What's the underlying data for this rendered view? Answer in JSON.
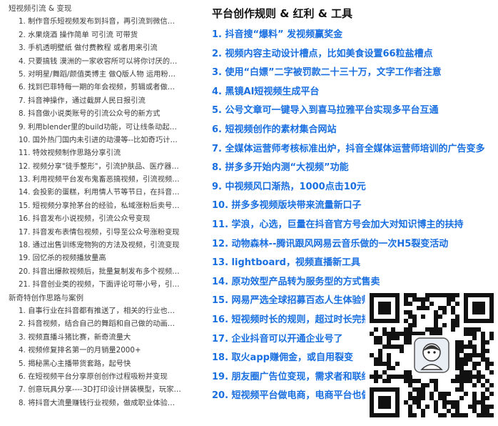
{
  "left": {
    "section1_title": "短视频引流 & 变现",
    "section1_items": [
      "1. 制作音乐短视频发布到抖音，再引流到微信卖车载…",
      "2. 水果烧酒 操作简单 可引流 可带货",
      "3. 手机透明壁纸 做付费教程 或者用来引流",
      "4. 只要搞钱 漠洲的一家收容所可以将你讨厌的人的名字…",
      "5. 对明星/舞蹈/颜值类博主 做Q版人物 运用粉丝经济",
      "6. 找到巴菲特每一期的年会视频，剪辑或者做图，效…",
      "7. 抖音神操作，通过截屏人民日报引流",
      "8. 抖音做小说类账号的引流公众号的新方式",
      "9. 利用blender里的build功能，可让线条动起来，再…",
      "10. 国外热门国内未引进的动漫等--比如奇巧计程车 o…",
      "11. 特效视频制作思路分享引流",
      "12. 视频分享\"徒手整形\"，引流护肤品、医疗器械厂…",
      "13. 利用视频平台发布鬼畜恶搞视频，引流视频制作…",
      "14. 会投影的蛋糕，利用情人节等节日，在抖音同城…",
      "15. 短视频分享抢茅台的经验，私域涨粉后卖号变现",
      "16. 抖音发布小说视频，引流公众号变现",
      "17. 抖音发布表情包视频，引导至公众号涨粉变现",
      "18. 通过出售训练宠物狗的方法及视频，引流变现",
      "19. 回忆杀的视频播放量高",
      "20. 抖音出爆款视频后，批量复制发布多个视频，涨…",
      "21. 抖音创业类的视频，下面评论可带小号，引流粉…"
    ],
    "section2_title": "新奇特创作思路与案例",
    "section2_items": [
      "1. 自事行业在抖音都有推送了，相关的行业也可以试试",
      "2. 抖音视频，结合自己的舞蹈和自己做的动画，这样…",
      "3. 视频直播斗猪比赛，新奇流量大",
      "4. 视频修复排名第一的月销量2000+",
      "5. 揭秘黑心主播带货套路，起号快",
      "6. 在短视频平台分享原创创作过程吸粉并变现",
      "7. 创意玩具分享----3D打印设计拼装模型，玩家自己…",
      "8. 将抖音大流量赚钱行业视频，做成职业体验，收获…"
    ]
  },
  "right": {
    "title": "平台创作规则 & 红利 & 工具",
    "items": [
      "1. 抖音搜“爆料” 发视频赢奖金",
      "2. 视频内容主动设计槽点，比如美食设置66粒盐槽点",
      "3. 使用“白嫖”二字被罚款二十三十万，文字工作者注意",
      "4. 黑镜AI短视频生成平台",
      "5. 公号文章可一键导入到喜马拉雅平台实现多平台互通",
      "6. 短视频创作的素材集合网站",
      "7. 全媒体运营师考核标准出炉，抖音全媒体运营师培训的广告变多",
      "8. 拼多多开始内测“大视频”功能",
      "9. 中视频风口渐热，1000点击10元",
      "10. 拼多多视频版块带来流量新口子",
      "11. 学浪，心选，巨量在抖音官方号会加大对知识博主的扶持",
      "12. 动物森林--腾讯跟风网易云音乐做的一次H5裂变活动",
      "13. lightboard，视频直播新工具",
      "14. 原功效型产品转为服务型的方式售卖",
      "15. 网易严选全球招募百态人生体验师，",
      "16. 短视频时长的规则，超过时长完播率",
      "17. 企业抖音可以开通企业号了",
      "18. 取火app赚佣金，或自用裂变",
      "19. 朋友圈广告位变现，需求者和联结者",
      "20. 短视频平台做电商，电商平台也做短"
    ]
  },
  "qr": {
    "icon": "qr-code-icon"
  },
  "colors": {
    "accent": "#1a6fe0",
    "title": "#111111",
    "text": "#3a3a3a"
  }
}
